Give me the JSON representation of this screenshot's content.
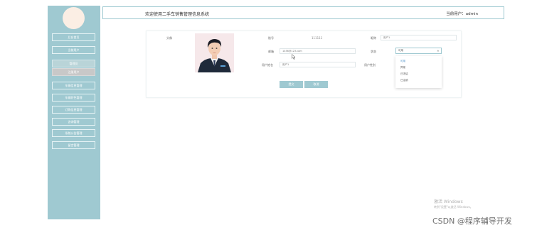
{
  "header": {
    "title": "欢迎使用二手车销售管理信息系统",
    "user_label": "当前用户：admin"
  },
  "sidebar": {
    "items": [
      {
        "label": "后台首页"
      },
      {
        "label": "当前用户"
      },
      {
        "label": "管理员"
      },
      {
        "label": "注册用户"
      },
      {
        "label": "车辆信息管理"
      },
      {
        "label": "车辆特色管理"
      },
      {
        "label": "订购信息管理"
      },
      {
        "label": "咨询管理"
      },
      {
        "label": "系统公告管理"
      },
      {
        "label": "留言管理"
      }
    ]
  },
  "form": {
    "avatar_label": "头像",
    "account_label": "账号",
    "account_value": "111111",
    "nickname_label": "昵称",
    "nickname_value": "用户1",
    "email_label": "邮箱",
    "email_value": "1456@123.com",
    "status_label": "状态",
    "status_value": "可用",
    "username_label": "用户姓名",
    "username_value": "用户1",
    "gender_label": "用户性别",
    "submit_label": "提交",
    "cancel_label": "取消"
  },
  "status_options": [
    {
      "label": "可用"
    },
    {
      "label": "异常"
    },
    {
      "label": "已冻结"
    },
    {
      "label": "已注销"
    }
  ],
  "overlay": {
    "windows_line1": "激活 Windows",
    "windows_line2": "转到\"设置\"以激活 Windows。",
    "watermark": "CSDN @程序辅导开发"
  },
  "colors": {
    "sidebar": "#9fc9d1",
    "accent": "#9fc9d1",
    "selected_option": "#4a90c8"
  }
}
